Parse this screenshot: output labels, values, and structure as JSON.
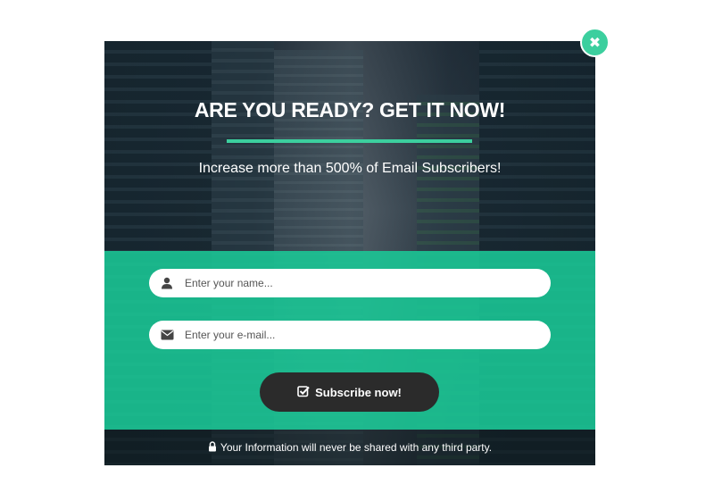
{
  "popup": {
    "title": "ARE YOU READY? GET IT NOW!",
    "subtitle": "Increase more than 500% of Email Subscribers!",
    "name_placeholder": "Enter your name...",
    "email_placeholder": "Enter your e-mail...",
    "subscribe_label": "Subscribe now!",
    "footer_text": "Your Information will never be shared with any third party."
  },
  "icons": {
    "close": "close-icon",
    "name": "user-icon",
    "email": "envelope-icon",
    "subscribe": "checkbox-icon",
    "footer": "lock-icon"
  },
  "colors": {
    "accent": "#3ccf9e",
    "band": "#1ac896",
    "button": "#2b2b2b"
  }
}
